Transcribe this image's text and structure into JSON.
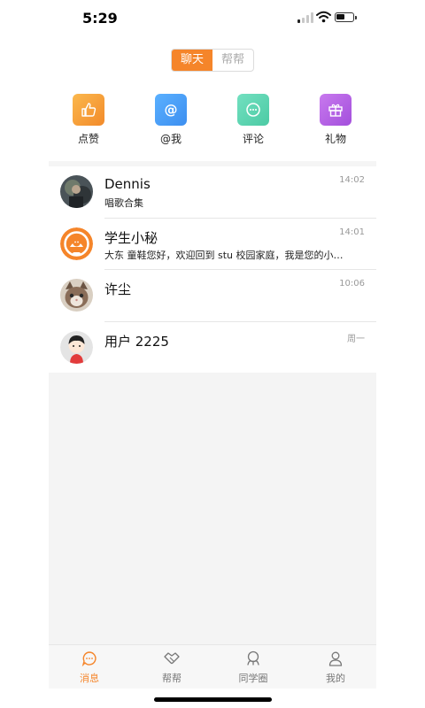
{
  "status": {
    "time": "5:29"
  },
  "segment": {
    "tabs": [
      {
        "label": "聊天",
        "active": true
      },
      {
        "label": "帮帮",
        "active": false
      }
    ]
  },
  "quick_actions": [
    {
      "label": "点赞",
      "icon": "thumbs-up-icon",
      "color": "#f5a03a"
    },
    {
      "label": "@我",
      "icon": "at-icon",
      "color": "#4d9cf3"
    },
    {
      "label": "评论",
      "icon": "comment-icon",
      "color": "#5bd2b0"
    },
    {
      "label": "礼物",
      "icon": "gift-icon",
      "color": "#b45fe0"
    }
  ],
  "conversations": [
    {
      "name": "Dennis",
      "message": "唱歌合集",
      "time": "14:02",
      "avatar": "dark-photo-avatar"
    },
    {
      "name": "学生小秘",
      "message": "大东 童鞋您好，欢迎回到 stu 校园家庭，我是您的小秘书～",
      "time": "14:01",
      "avatar": "orange-mascot-avatar"
    },
    {
      "name": "许尘",
      "message": "",
      "time": "10:06",
      "avatar": "cat-photo-avatar"
    },
    {
      "name": "用户 2225",
      "message": "",
      "time": "周一",
      "avatar": "cartoon-person-avatar"
    }
  ],
  "tabbar": [
    {
      "label": "消息",
      "icon": "chat-bubble-icon",
      "active": true
    },
    {
      "label": "帮帮",
      "icon": "handshake-icon",
      "active": false
    },
    {
      "label": "同学圈",
      "icon": "people-circle-icon",
      "active": false
    },
    {
      "label": "我的",
      "icon": "person-icon",
      "active": false
    }
  ],
  "colors": {
    "accent": "#f5852a"
  }
}
